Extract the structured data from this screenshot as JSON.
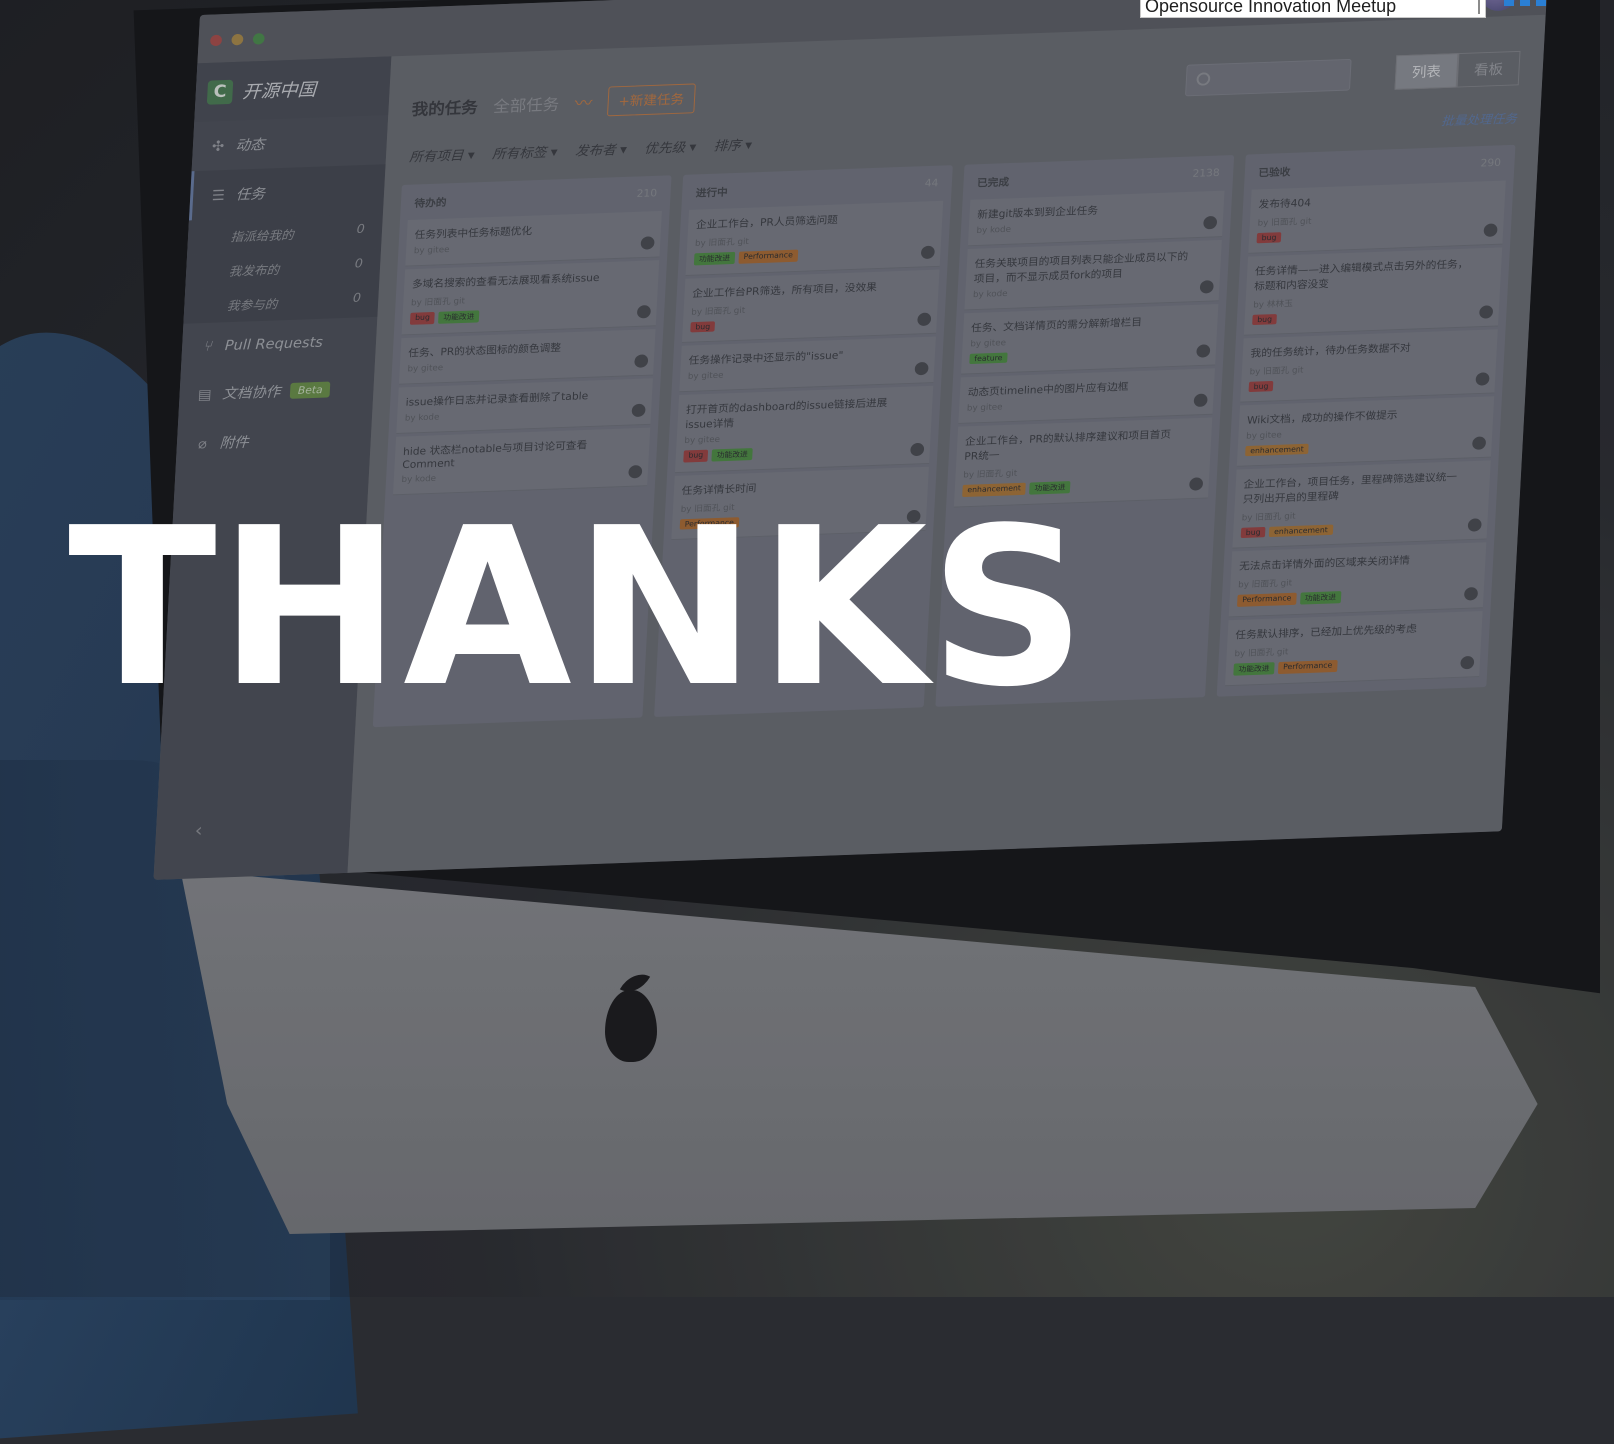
{
  "header_strip": {
    "event_name": "Opensource Innovation Meetup"
  },
  "overlay": {
    "headline": "THANKS"
  },
  "app": {
    "brand": "开源中国",
    "sidebar": {
      "items": [
        {
          "icon": "activity-icon",
          "label": "动态"
        },
        {
          "icon": "tasks-icon",
          "label": "任务"
        },
        {
          "icon": "pull-request-icon",
          "label": "Pull Requests"
        },
        {
          "icon": "docs-icon",
          "label": "文档协作",
          "badge": "Beta"
        },
        {
          "icon": "attachment-icon",
          "label": "附件"
        }
      ],
      "task_sub": [
        {
          "label": "指派给我的",
          "count": "0"
        },
        {
          "label": "我发布的",
          "count": "0"
        },
        {
          "label": "我参与的",
          "count": "0"
        }
      ]
    },
    "header": {
      "tab_mine": "我的任务",
      "tab_all": "全部任务",
      "new_task": "+新建任务",
      "view_list": "列表",
      "view_board": "看板"
    },
    "filters": {
      "items": [
        "所有项目 ▾",
        "所有标签 ▾",
        "发布者 ▾",
        "优先级 ▾",
        "排序 ▾"
      ],
      "batch": "批量处理任务"
    },
    "columns": [
      {
        "title": "待办的",
        "count": "210",
        "cards": [
          {
            "title": "任务列表中任务标题优化",
            "meta": "by gitee"
          },
          {
            "title": "多域名搜索的查看无法展现看系统issue",
            "meta": "by 旧面孔 git",
            "tags": [
              "bug",
              "功能改进"
            ]
          },
          {
            "title": "任务、PR的状态图标的颜色调整",
            "meta": "by gitee"
          },
          {
            "title": "issue操作日志并记录查看删除了table",
            "meta": "by kode"
          },
          {
            "title": "hide 状态栏notable与项目讨论可查看Comment",
            "meta": "by kode"
          }
        ]
      },
      {
        "title": "进行中",
        "count": "44",
        "cards": [
          {
            "title": "企业工作台，PR人员筛选问题",
            "meta": "by 旧面孔 git",
            "tags": [
              "功能改进",
              "Performance"
            ]
          },
          {
            "title": "企业工作台PR筛选，所有项目，没效果",
            "meta": "by 旧面孔 git",
            "tags": [
              "bug"
            ]
          },
          {
            "title": "任务操作记录中还显示的\"issue\"",
            "meta": "by gitee"
          },
          {
            "title": "打开首页的dashboard的issue链接后进展issue详情",
            "meta": "by gitee",
            "tags": [
              "bug",
              "功能改进"
            ]
          },
          {
            "title": "任务详情长时间",
            "meta": "by 旧面孔 git",
            "tags": [
              "Performance"
            ]
          }
        ]
      },
      {
        "title": "已完成",
        "count": "2138",
        "cards": [
          {
            "title": "新建git版本到到企业任务",
            "meta": "by kode"
          },
          {
            "title": "任务关联项目的项目列表只能企业成员以下的项目，而不显示成员fork的项目",
            "meta": "by kode"
          },
          {
            "title": "任务、文档详情页的需分解新增栏目",
            "meta": "by gitee",
            "tags": [
              "feature"
            ]
          },
          {
            "title": "动态页timeline中的图片应有边框",
            "meta": "by gitee"
          },
          {
            "title": "企业工作台，PR的默认排序建议和项目首页PR统一",
            "meta": "by 旧面孔 git",
            "tags": [
              "enhancement",
              "功能改进"
            ]
          }
        ]
      },
      {
        "title": "已验收",
        "count": "290",
        "cards": [
          {
            "title": "发布待404",
            "meta": "by 旧面孔 git",
            "tags": [
              "bug"
            ]
          },
          {
            "title": "任务详情——进入编辑模式点击另外的任务，标题和内容没变",
            "meta": "by 林林玉",
            "tags": [
              "bug"
            ]
          },
          {
            "title": "我的任务统计，待办任务数据不对",
            "meta": "by 旧面孔 git",
            "tags": [
              "bug"
            ]
          },
          {
            "title": "Wiki文档，成功的操作不做提示",
            "meta": "by gitee",
            "tags": [
              "enhancement"
            ]
          },
          {
            "title": "企业工作台，项目任务，里程碑筛选建议统一只列出开启的里程碑",
            "meta": "by 旧面孔 git",
            "tags": [
              "bug",
              "enhancement"
            ]
          },
          {
            "title": "无法点击详情外面的区域来关闭详情",
            "meta": "by 旧面孔 git",
            "tags": [
              "Performance",
              "功能改进"
            ]
          },
          {
            "title": "任务默认排序，已经加上优先级的考虑",
            "meta": "by 旧面孔 git",
            "tags": [
              "功能改进",
              "Performance"
            ]
          }
        ]
      }
    ]
  }
}
